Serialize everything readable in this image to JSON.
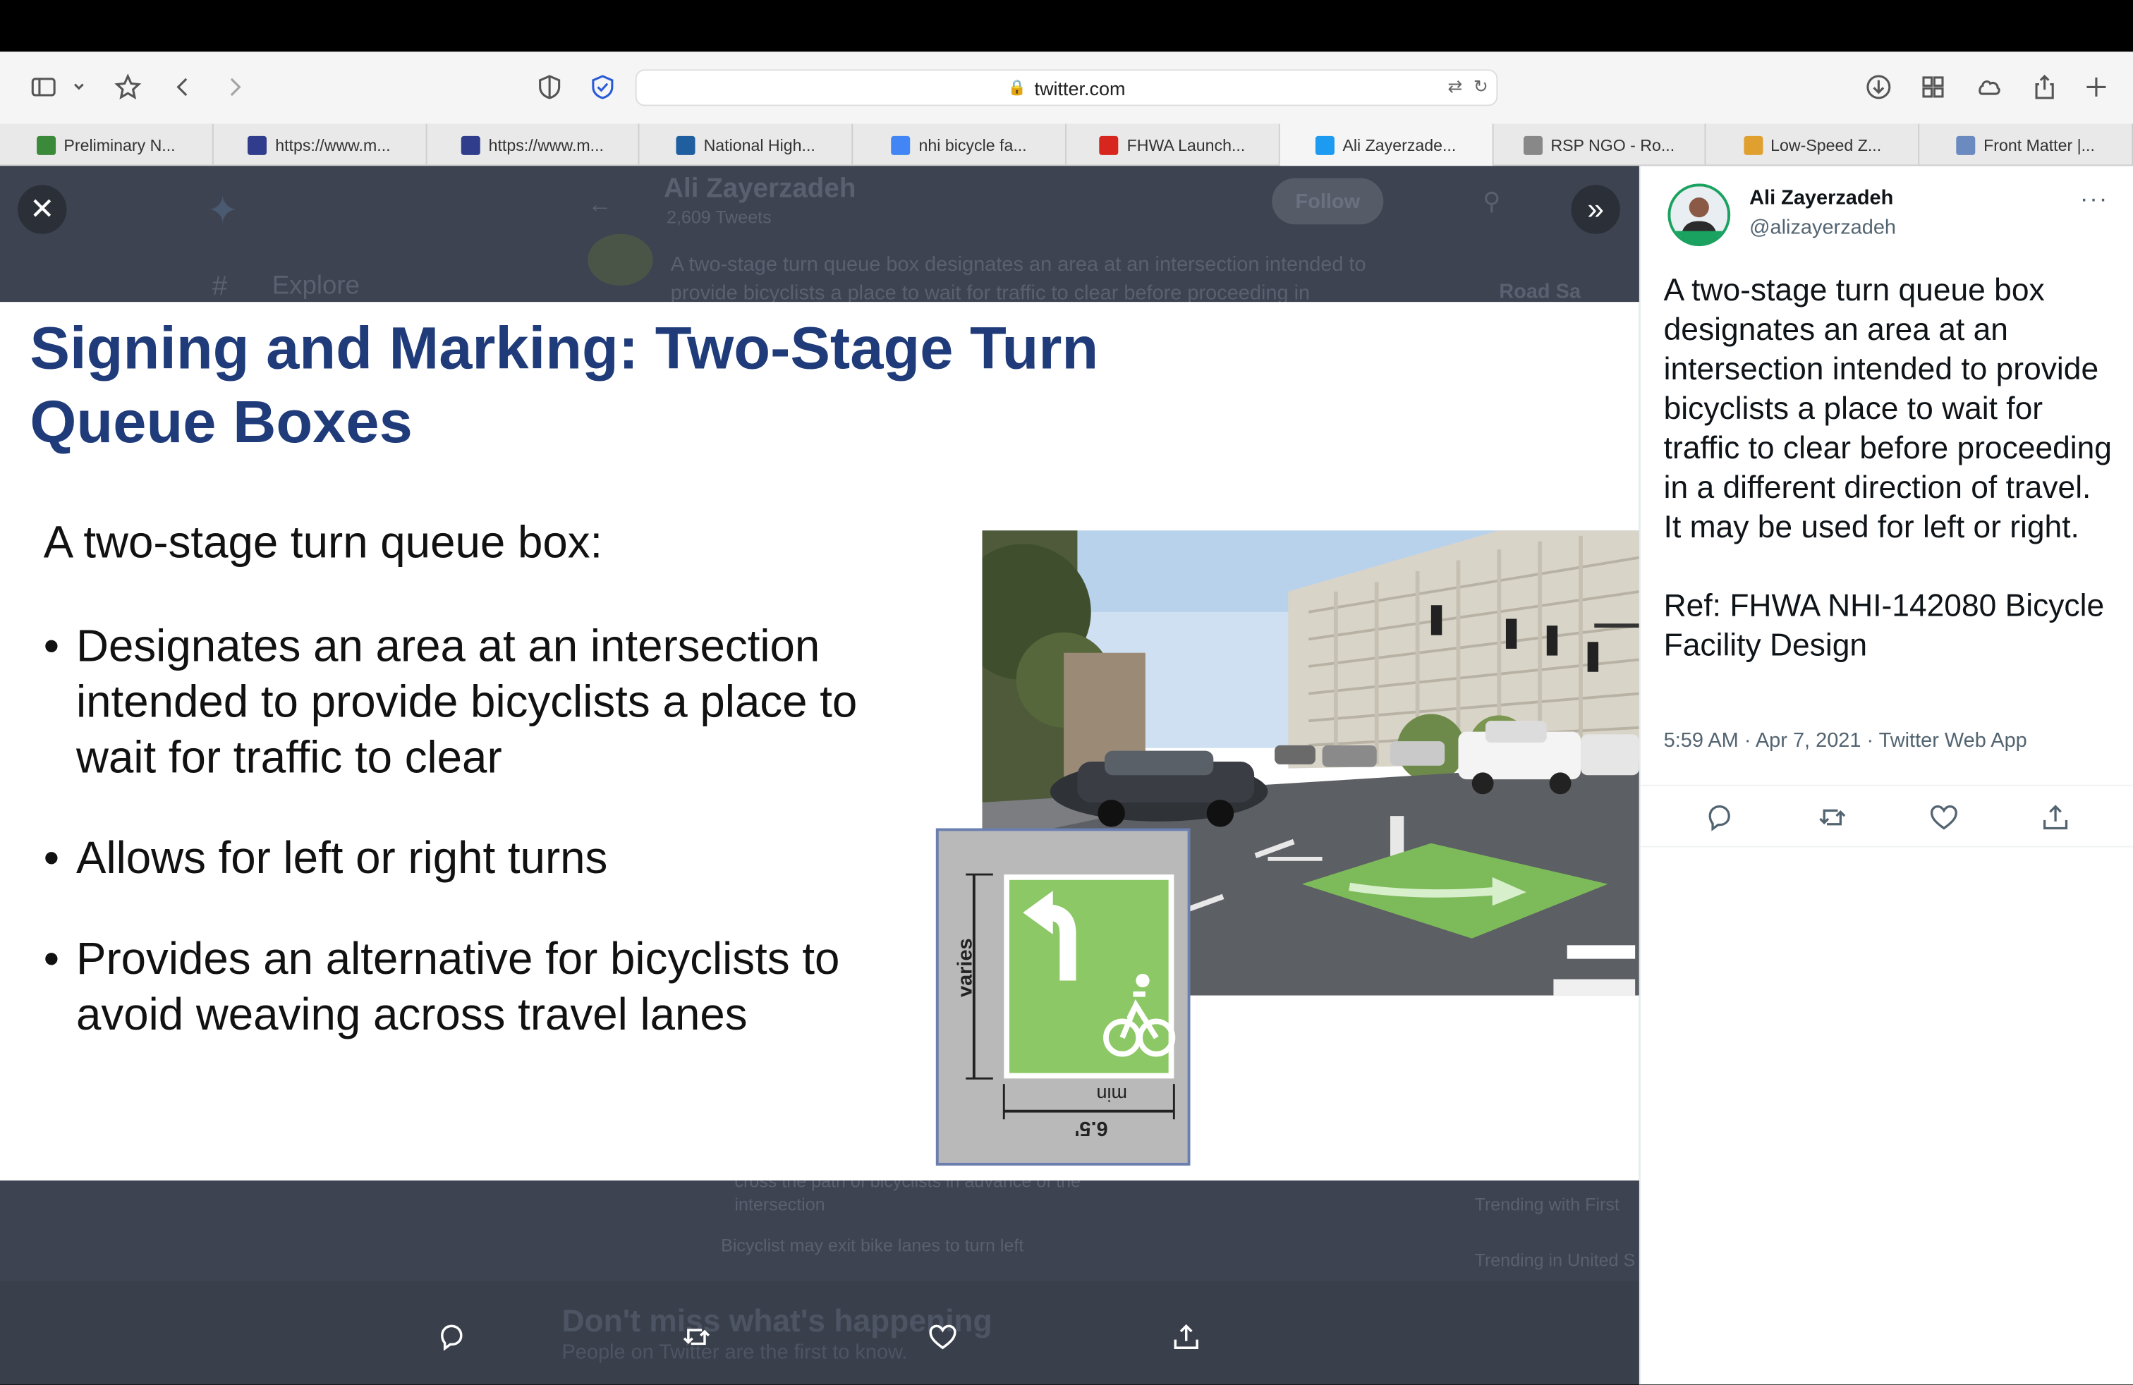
{
  "browser": {
    "url": "twitter.com"
  },
  "tabs": [
    {
      "label": "Preliminary N...",
      "color": "#3a8a3a"
    },
    {
      "label": "https://www.m...",
      "color": "#2f3d8c"
    },
    {
      "label": "https://www.m...",
      "color": "#2f3d8c"
    },
    {
      "label": "National High...",
      "color": "#1f5fa0"
    },
    {
      "label": "nhi bicycle fa...",
      "color": "#4285f4"
    },
    {
      "label": "FHWA Launch...",
      "color": "#d7261e"
    },
    {
      "label": "Ali Zayerzade...",
      "color": "#1d9bf0"
    },
    {
      "label": "RSP NGO - Ro...",
      "color": "#888888"
    },
    {
      "label": "Low-Speed Z...",
      "color": "#e0a030"
    },
    {
      "label": "Front Matter |...",
      "color": "#6a8ac0"
    }
  ],
  "slide": {
    "title": "Signing and Marking: Two-Stage Turn Queue Boxes",
    "intro": "A two-stage turn queue box:",
    "bullets": [
      "Designates an area at an intersection intended to provide bicyclists a place to wait for traffic to clear",
      "Allows for left or right turns",
      "Provides an alternative for bicyclists to avoid weaving across travel lanes"
    ],
    "diagram": {
      "side_label": "varies",
      "min_label": "min",
      "width_label": "6.5'"
    }
  },
  "tweet": {
    "author_name": "Ali Zayerzadeh",
    "author_handle": "@alizayerzadeh",
    "text": "A two-stage turn queue box designates an area at an intersection intended to provide bicyclists a place to wait for traffic to clear before proceeding in a different direction of travel. It may be used for left or right.\n\nRef: FHWA NHI-142080 Bicycle Facility Design",
    "meta": "5:59 AM · Apr 7, 2021 · Twitter Web App"
  },
  "background_ghost": {
    "profile_name": "Ali Zayerzadeh",
    "tweet_count": "2,609 Tweets",
    "follow": "Follow",
    "explore": "Explore",
    "snippet": "A two-stage turn queue box designates an area at an intersection intended to provide bicyclists a place to wait for traffic to clear before proceeding in",
    "road": "Road Sa",
    "bottom1": "cross the path of bicyclists in advance of the intersection",
    "bottom2": "Bicyclist may exit bike lanes to turn left",
    "trend1": "Trending with First",
    "trend2": "Trending in United S",
    "banner_title": "Don't miss what's happening",
    "banner_sub": "People on Twitter are the first to know."
  }
}
